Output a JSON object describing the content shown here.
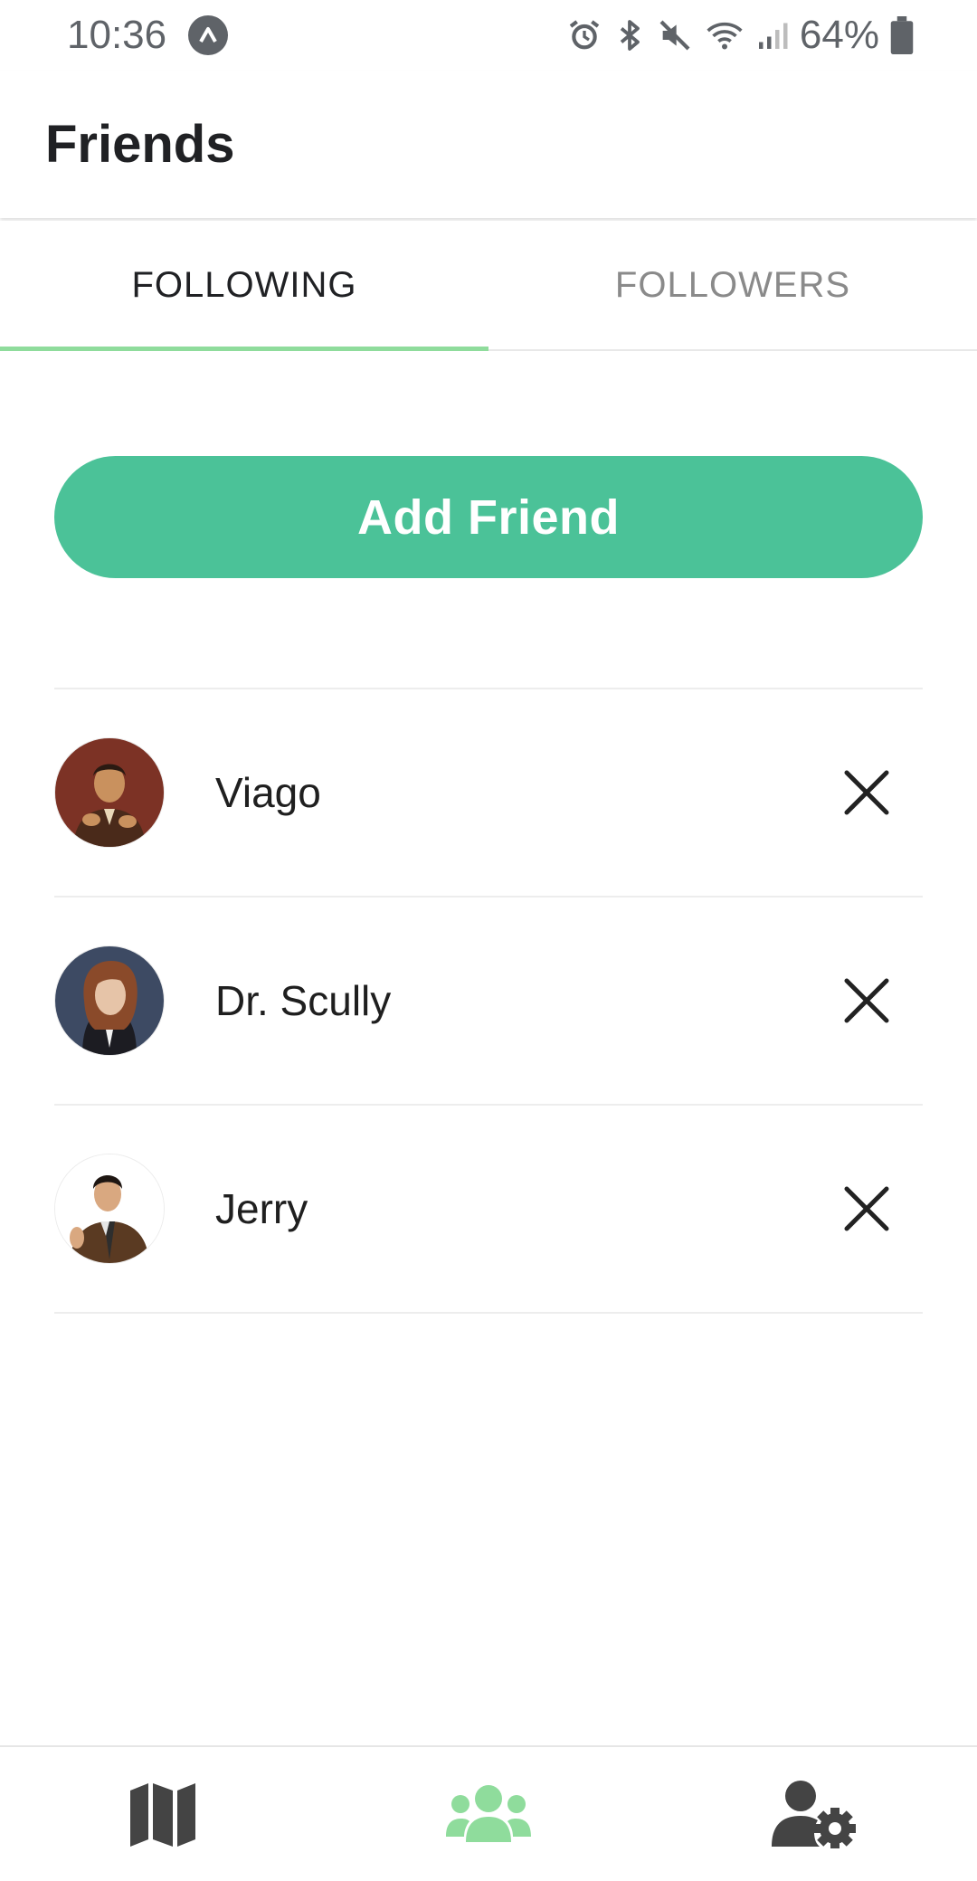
{
  "status_bar": {
    "time": "10:36",
    "battery": "64%",
    "icons": [
      "app-notification-icon",
      "alarm-icon",
      "bluetooth-icon",
      "mute-icon",
      "wifi-icon",
      "signal-icon",
      "battery-icon"
    ]
  },
  "header": {
    "title": "Friends"
  },
  "tabs": [
    {
      "label": "FOLLOWING",
      "active": true
    },
    {
      "label": "FOLLOWERS",
      "active": false
    }
  ],
  "add_button": {
    "label": "Add Friend"
  },
  "friends": [
    {
      "name": "Viago",
      "action_icon": "close-icon"
    },
    {
      "name": "Dr. Scully",
      "action_icon": "close-icon"
    },
    {
      "name": "Jerry",
      "action_icon": "close-icon"
    }
  ],
  "bottom_nav": [
    {
      "icon": "map-icon",
      "active": false
    },
    {
      "icon": "friends-icon",
      "active": true
    },
    {
      "icon": "user-settings-icon",
      "active": false
    }
  ],
  "colors": {
    "accent": "#4bc298",
    "tab_indicator": "#8fdc9c",
    "nav_active": "#8fdc9c",
    "nav_inactive": "#444444"
  }
}
